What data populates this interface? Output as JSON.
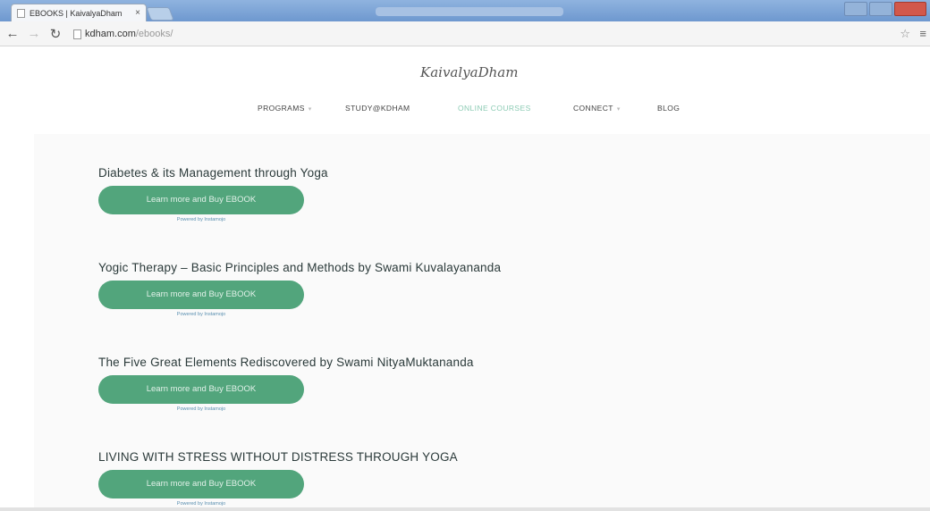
{
  "browser": {
    "tab_title": "EBOOKS | KaivalyaDham",
    "tab_close": "×",
    "url_domain": "kdham.com",
    "url_path": "/ebooks/"
  },
  "site": {
    "logo": "KaivalyaDham",
    "nav": [
      {
        "label": "PROGRAMS",
        "has_caret": true
      },
      {
        "label": "STUDY@KDHAM",
        "has_caret": false
      },
      {
        "label": "ONLINE COURSES",
        "has_caret": false,
        "active": true
      },
      {
        "label": "CONNECT",
        "has_caret": true
      },
      {
        "label": "BLOG",
        "has_caret": false
      }
    ],
    "nav_caret": "▾"
  },
  "books": [
    {
      "title": "Diabetes & its Management through Yoga",
      "button": "Learn more and Buy EBOOK",
      "powered": "Powered by Instamojo"
    },
    {
      "title": "Yogic Therapy – Basic Principles and Methods by Swami Kuvalayananda",
      "button": "Learn more and Buy EBOOK",
      "powered": "Powered by Instamojo"
    },
    {
      "title": "The Five Great Elements Rediscovered by Swami NityaMuktananda",
      "button": "Learn more and Buy EBOOK",
      "powered": "Powered by Instamojo"
    },
    {
      "title": "LIVING WITH STRESS WITHOUT DISTRESS THROUGH YOGA",
      "button": "Learn more and Buy EBOOK",
      "powered": "Powered by Instamojo"
    }
  ],
  "colors": {
    "button_bg": "#52a57c",
    "nav_active": "#8ccbb4",
    "titlebar": "#7aa3d6"
  }
}
